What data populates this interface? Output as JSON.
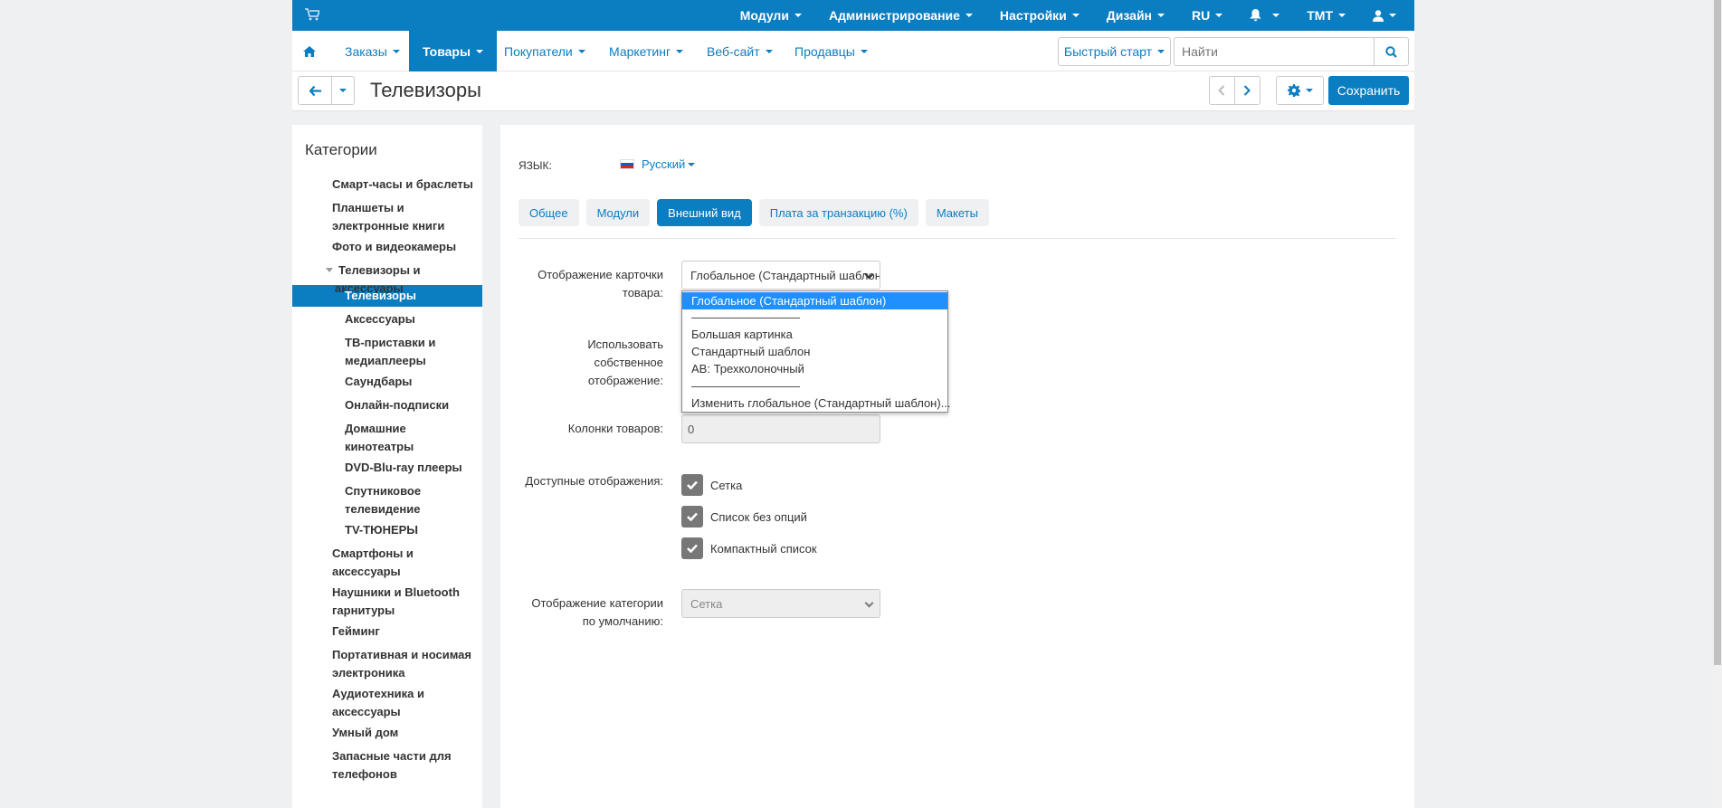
{
  "topbar": {
    "menu": [
      "Модули",
      "Администрирование",
      "Настройки",
      "Дизайн",
      "RU",
      "",
      "TMT",
      ""
    ]
  },
  "nav": {
    "items": [
      "Заказы",
      "Товары",
      "Покупатели",
      "Маркетинг",
      "Веб-сайт",
      "Продавцы"
    ],
    "quick_start": "Быстрый старт",
    "search_placeholder": "Найти"
  },
  "header": {
    "title": "Телевизоры",
    "save_label": "Сохранить"
  },
  "sidebar": {
    "title": "Категории",
    "items": [
      "Смарт-часы и браслеты",
      "Планшеты и электронные книги",
      "Фото и видеокамеры",
      "Телевизоры и аксессуары",
      "Телевизоры",
      "Аксессуары",
      "ТВ-приставки и медиаплееры",
      "Саундбары",
      "Онлайн-подписки",
      "Домашние кинотеатры",
      "DVD-Blu-ray плееры",
      "Спутниковое телевидение",
      "TV-ТЮНЕРЫ",
      "Смартфоны и аксессуары",
      "Наушники и Bluetooth гарнитуры",
      "Гейминг",
      "Портативная и носимая электроника",
      "Аудиотехника и аксессуары",
      "Умный дом",
      "Запасные части для телефонов"
    ]
  },
  "main": {
    "lang_label": "ЯЗЫК:",
    "lang_value": "Русский",
    "tabs": [
      "Общее",
      "Модули",
      "Внешний вид",
      "Плата за транзакцию (%)",
      "Макеты"
    ],
    "active_tab": "Внешний вид",
    "fields": {
      "card_display_label": "Отображение карточки товара:",
      "card_display_value": "Глобальное (Стандартный шаблон)",
      "own_display_label": "Использовать собственное отображение:",
      "columns_label": "Колонки товаров:",
      "columns_value": "0",
      "available_label": "Доступные отображения:",
      "available_options": [
        "Сетка",
        "Список без опций",
        "Компактный список"
      ],
      "default_label": "Отображение категории по умолчанию:",
      "default_value": "Сетка"
    },
    "dropdown_options": [
      "Глобальное (Стандартный шаблон)",
      "—",
      "Большая картинка",
      "Стандартный шаблон",
      "AB: Трехколоночный",
      "—",
      "Изменить глобальное (Стандартный шаблон)..."
    ]
  },
  "colors": {
    "accent": "#0b7dc1",
    "background": "#eef0f2"
  }
}
